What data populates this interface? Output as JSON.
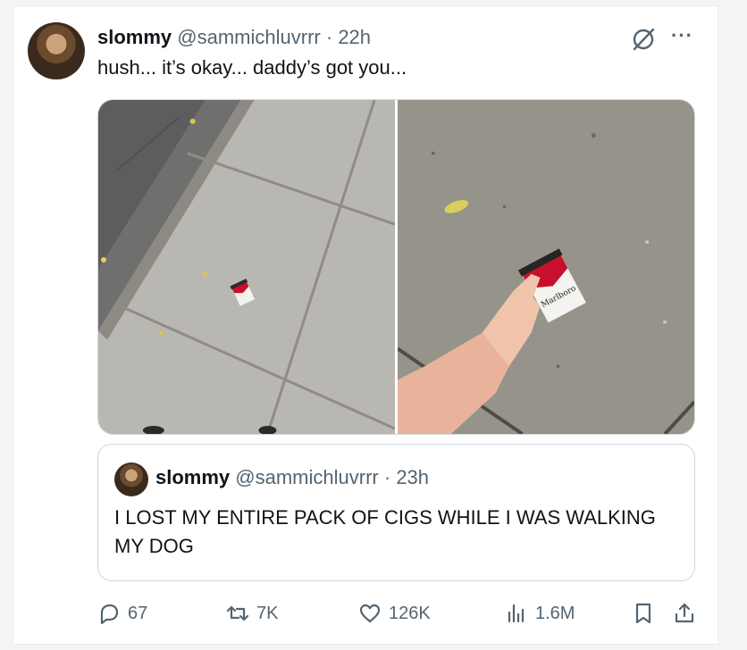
{
  "tweet": {
    "display_name": "slommy",
    "handle": "@sammichluvrrr",
    "separator": "·",
    "time": "22h",
    "text": "hush... it’s okay... daddy’s got you...",
    "more_label": "···"
  },
  "quoted": {
    "display_name": "slommy",
    "handle": "@sammichluvrrr",
    "separator": "·",
    "time": "23h",
    "text": "I LOST MY ENTIRE PACK OF CIGS WHILE I WAS WALKING MY DOG"
  },
  "media": {
    "left_pack_text": "Marlboro",
    "right_pack_text": "Marlboro"
  },
  "actions": {
    "replies": "67",
    "reposts": "7K",
    "likes": "126K",
    "views": "1.6M"
  },
  "icons": [
    "grok-icon",
    "more-icon",
    "reply-icon",
    "repost-icon",
    "like-icon",
    "views-icon",
    "bookmark-icon",
    "share-icon"
  ],
  "colors": {
    "text": "#0f1419",
    "muted": "#536471",
    "border": "#cfd9de",
    "marlboro_red": "#c8102e"
  }
}
